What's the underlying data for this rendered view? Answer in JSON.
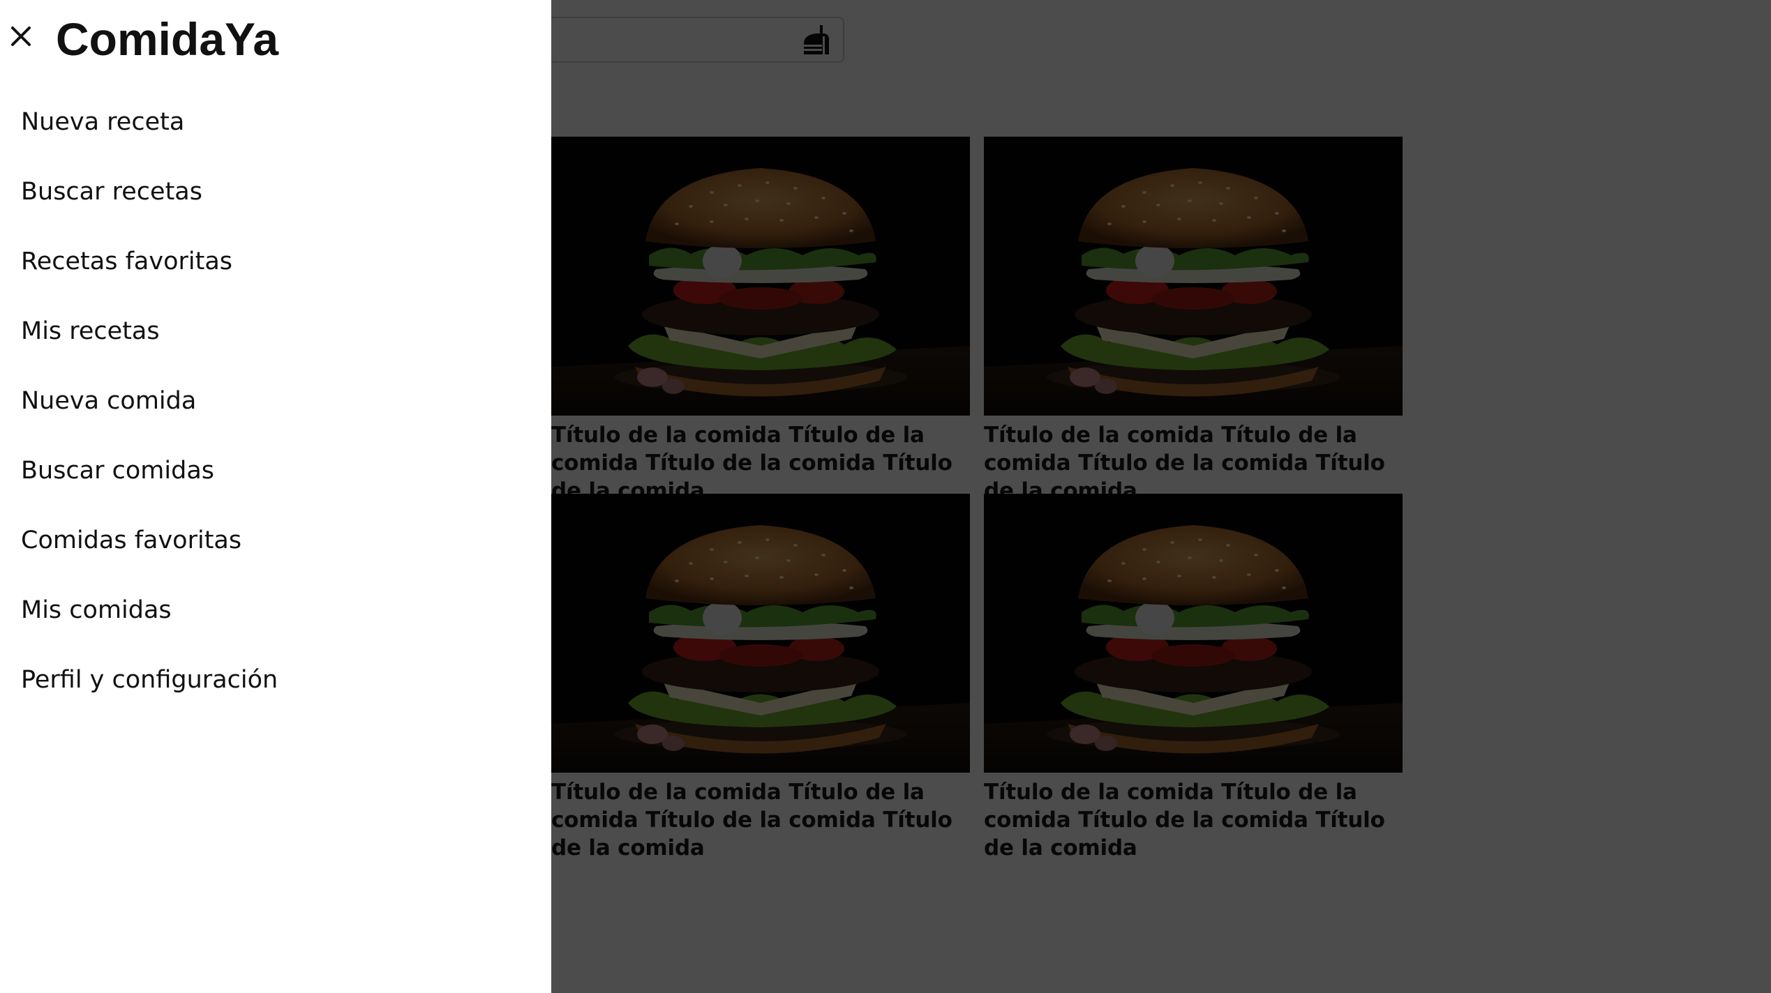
{
  "header": {
    "search_placeholder": "",
    "search_value": "",
    "search_icon": "dish-icon"
  },
  "cards": [
    {
      "title": "Título de la comida Título de la comida Título de la comida Título de la comida",
      "image": "burger-photo"
    },
    {
      "title": "Título de la comida Título de la comida Título de la comida Título de la comida",
      "image": "burger-photo"
    },
    {
      "title": "Título de la comida Título de la comida Título de la comida Título de la comida",
      "image": "burger-photo"
    },
    {
      "title": "Título de la comida Título de la comida Título de la comida Título de la comida",
      "image": "burger-photo"
    },
    {
      "title": "Título de la comida Título de la comida Título de la comida Título de la comida",
      "image": "burger-photo"
    },
    {
      "title": "Título de la comida Título de la comida Título de la comida Título de la comida",
      "image": "burger-photo"
    }
  ],
  "drawer": {
    "brand": "ComidaYa",
    "close_icon": "close-icon",
    "items": [
      {
        "label": "Nueva receta"
      },
      {
        "label": "Buscar recetas"
      },
      {
        "label": "Recetas favoritas"
      },
      {
        "label": "Mis recetas"
      },
      {
        "label": "Nueva comida"
      },
      {
        "label": "Buscar comidas"
      },
      {
        "label": "Comidas favoritas"
      },
      {
        "label": "Mis comidas"
      },
      {
        "label": "Perfil y configuración"
      }
    ]
  },
  "colors": {
    "overlay": "#000000b3",
    "drawer_background": "#ffffff",
    "text": "#111111"
  }
}
